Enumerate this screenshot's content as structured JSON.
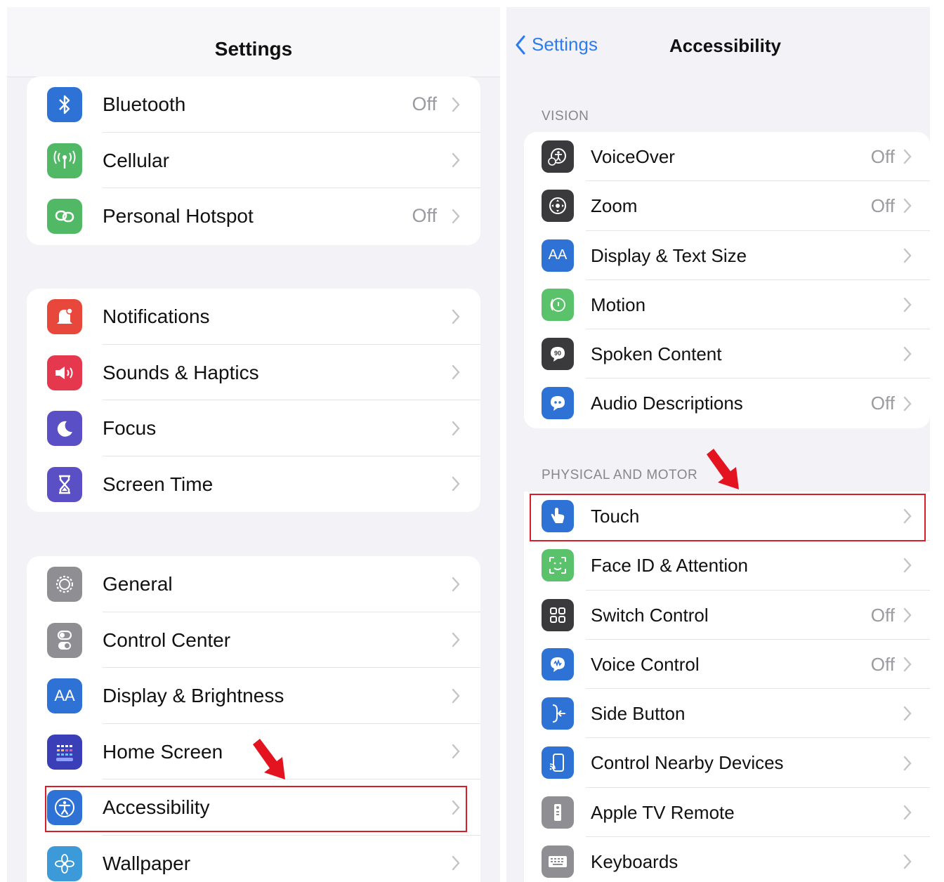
{
  "left": {
    "title": "Settings",
    "groups": [
      [
        {
          "label": "Bluetooth",
          "value": "Off",
          "icon": "bluetooth-icon"
        },
        {
          "label": "Cellular",
          "value": "",
          "icon": "cellular-icon"
        },
        {
          "label": "Personal Hotspot",
          "value": "Off",
          "icon": "hotspot-icon"
        }
      ],
      [
        {
          "label": "Notifications",
          "value": "",
          "icon": "notifications-icon"
        },
        {
          "label": "Sounds & Haptics",
          "value": "",
          "icon": "sounds-icon"
        },
        {
          "label": "Focus",
          "value": "",
          "icon": "focus-icon"
        },
        {
          "label": "Screen Time",
          "value": "",
          "icon": "screen-time-icon"
        }
      ],
      [
        {
          "label": "General",
          "value": "",
          "icon": "gear-icon"
        },
        {
          "label": "Control Center",
          "value": "",
          "icon": "control-center-icon"
        },
        {
          "label": "Display & Brightness",
          "value": "",
          "icon": "display-icon"
        },
        {
          "label": "Home Screen",
          "value": "",
          "icon": "home-screen-icon"
        },
        {
          "label": "Accessibility",
          "value": "",
          "icon": "accessibility-icon"
        },
        {
          "label": "Wallpaper",
          "value": "",
          "icon": "wallpaper-icon"
        }
      ]
    ]
  },
  "right": {
    "back_label": "Settings",
    "title": "Accessibility",
    "sections": [
      {
        "header": "VISION",
        "items": [
          {
            "label": "VoiceOver",
            "value": "Off",
            "icon": "voiceover-icon"
          },
          {
            "label": "Zoom",
            "value": "Off",
            "icon": "zoom-icon"
          },
          {
            "label": "Display & Text Size",
            "value": "",
            "icon": "text-size-icon"
          },
          {
            "label": "Motion",
            "value": "",
            "icon": "motion-icon"
          },
          {
            "label": "Spoken Content",
            "value": "",
            "icon": "spoken-content-icon"
          },
          {
            "label": "Audio Descriptions",
            "value": "Off",
            "icon": "audio-descriptions-icon"
          }
        ]
      },
      {
        "header": "PHYSICAL AND MOTOR",
        "items": [
          {
            "label": "Touch",
            "value": "",
            "icon": "touch-icon"
          },
          {
            "label": "Face ID & Attention",
            "value": "",
            "icon": "face-id-icon"
          },
          {
            "label": "Switch Control",
            "value": "Off",
            "icon": "switch-control-icon"
          },
          {
            "label": "Voice Control",
            "value": "Off",
            "icon": "voice-control-icon"
          },
          {
            "label": "Side Button",
            "value": "",
            "icon": "side-button-icon"
          },
          {
            "label": "Control Nearby Devices",
            "value": "",
            "icon": "nearby-devices-icon"
          },
          {
            "label": "Apple TV Remote",
            "value": "",
            "icon": "tv-remote-icon"
          },
          {
            "label": "Keyboards",
            "value": "",
            "icon": "keyboard-icon"
          }
        ]
      }
    ]
  },
  "colors": {
    "accent": "#2b7cf0",
    "highlight": "#d81e2a",
    "background": "#f2f2f7"
  }
}
